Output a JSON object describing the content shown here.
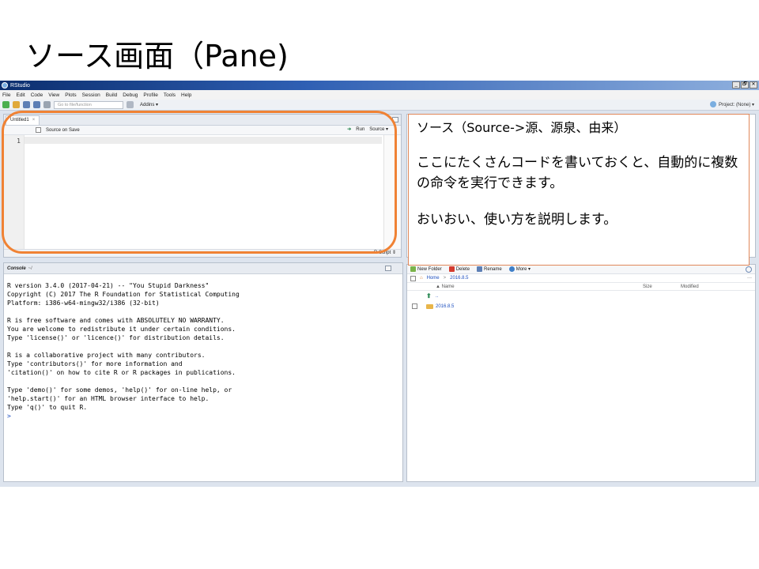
{
  "slide": {
    "title": "ソース画面（Pane)"
  },
  "window": {
    "app_title": "RStudio",
    "buttons": [
      "_",
      "🗗",
      "✕"
    ]
  },
  "menu": [
    "File",
    "Edit",
    "Code",
    "View",
    "Plots",
    "Session",
    "Build",
    "Debug",
    "Profile",
    "Tools",
    "Help"
  ],
  "toolbar": {
    "goto_placeholder": "Go to file/function",
    "addins": "Addins ▾",
    "project": "Project: (None) ▾"
  },
  "source_pane": {
    "tab_label": "Untitled1",
    "tab_close": "×",
    "source_on_save": "Source on Save",
    "run": "Run",
    "source": "Source ▾",
    "line_number": "1",
    "status_right": "R Script ⇕"
  },
  "console": {
    "title": "Console",
    "path": "~/",
    "output": "R version 3.4.0 (2017-04-21) -- \"You Stupid Darkness\"\nCopyright (C) 2017 The R Foundation for Statistical Computing\nPlatform: i386-w64-mingw32/i386 (32-bit)\n\nR is free software and comes with ABSOLUTELY NO WARRANTY.\nYou are welcome to redistribute it under certain conditions.\nType 'license()' or 'licence()' for distribution details.\n\nR is a collaborative project with many contributors.\nType 'contributors()' for more information and\n'citation()' on how to cite R or R packages in publications.\n\nType 'demo()' for some demos, 'help()' for on-line help, or\n'help.start()' for an HTML browser interface to help.\nType 'q()' to quit R.\n",
    "prompt": ">"
  },
  "files_pane": {
    "new_folder": "New Folder",
    "delete": "Delete",
    "rename": "Rename",
    "more": "More ▾",
    "bread_home": "Home",
    "bread_sep": ">",
    "bread_dir": "2016.8.5",
    "more_dots": "···",
    "col_name": "▲ Name",
    "col_size": "Size",
    "col_modified": "Modified",
    "rows": [
      {
        "name": "..",
        "type": "up"
      },
      {
        "name": "2016.8.5",
        "type": "folder"
      }
    ]
  },
  "callout": {
    "line1": "ソース（Source->源、源泉、由来）",
    "line2": "ここにたくさんコードを書いておくと、自動的に複数の命令を実行できます。",
    "line3": "おいおい、使い方を説明します。"
  },
  "colors": {
    "highlight": "#f08234",
    "callout_border": "#e0885a",
    "titlebar": "#0b2e6e"
  }
}
